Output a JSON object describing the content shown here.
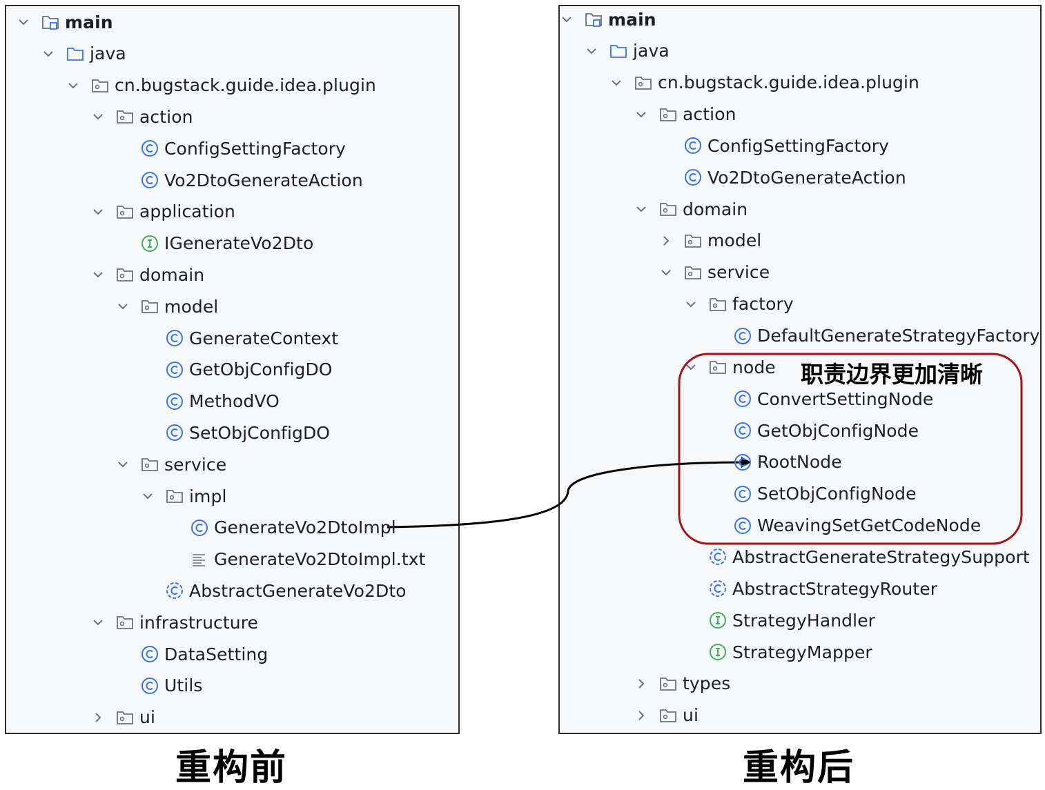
{
  "left_panel": {
    "caption": "重构前",
    "rows": [
      {
        "label": "main",
        "level": 0,
        "icon": "module",
        "expanded": true,
        "bold": true
      },
      {
        "label": "java",
        "level": 1,
        "icon": "source-folder",
        "expanded": true
      },
      {
        "label": "cn.bugstack.guide.idea.plugin",
        "level": 2,
        "icon": "package",
        "expanded": true
      },
      {
        "label": "action",
        "level": 3,
        "icon": "package",
        "expanded": true
      },
      {
        "label": "ConfigSettingFactory",
        "level": 4,
        "icon": "class"
      },
      {
        "label": "Vo2DtoGenerateAction",
        "level": 4,
        "icon": "class"
      },
      {
        "label": "application",
        "level": 3,
        "icon": "package",
        "expanded": true
      },
      {
        "label": "IGenerateVo2Dto",
        "level": 4,
        "icon": "interface"
      },
      {
        "label": "domain",
        "level": 3,
        "icon": "package",
        "expanded": true
      },
      {
        "label": "model",
        "level": 4,
        "icon": "package",
        "expanded": true
      },
      {
        "label": "GenerateContext",
        "level": 5,
        "icon": "class"
      },
      {
        "label": "GetObjConfigDO",
        "level": 5,
        "icon": "class"
      },
      {
        "label": "MethodVO",
        "level": 5,
        "icon": "class"
      },
      {
        "label": "SetObjConfigDO",
        "level": 5,
        "icon": "class"
      },
      {
        "label": "service",
        "level": 4,
        "icon": "package",
        "expanded": true
      },
      {
        "label": "impl",
        "level": 5,
        "icon": "package",
        "expanded": true
      },
      {
        "label": "GenerateVo2DtoImpl",
        "level": 6,
        "icon": "class"
      },
      {
        "label": "GenerateVo2DtoImpl.txt",
        "level": 6,
        "icon": "text-file"
      },
      {
        "label": "AbstractGenerateVo2Dto",
        "level": 5,
        "icon": "abstract-class"
      },
      {
        "label": "infrastructure",
        "level": 3,
        "icon": "package",
        "expanded": true
      },
      {
        "label": "DataSetting",
        "level": 4,
        "icon": "class"
      },
      {
        "label": "Utils",
        "level": 4,
        "icon": "class"
      },
      {
        "label": "ui",
        "level": 3,
        "icon": "package",
        "expanded": false
      }
    ]
  },
  "right_panel": {
    "caption": "重构后",
    "note": "职责边界更加清晰",
    "rows": [
      {
        "label": "main",
        "level": 0,
        "icon": "module",
        "expanded": true,
        "bold": true
      },
      {
        "label": "java",
        "level": 1,
        "icon": "source-folder",
        "expanded": true
      },
      {
        "label": "cn.bugstack.guide.idea.plugin",
        "level": 2,
        "icon": "package",
        "expanded": true
      },
      {
        "label": "action",
        "level": 3,
        "icon": "package",
        "expanded": true
      },
      {
        "label": "ConfigSettingFactory",
        "level": 4,
        "icon": "class"
      },
      {
        "label": "Vo2DtoGenerateAction",
        "level": 4,
        "icon": "class"
      },
      {
        "label": "domain",
        "level": 3,
        "icon": "package",
        "expanded": true
      },
      {
        "label": "model",
        "level": 4,
        "icon": "package",
        "expanded": false
      },
      {
        "label": "service",
        "level": 4,
        "icon": "package",
        "expanded": true
      },
      {
        "label": "factory",
        "level": 5,
        "icon": "package",
        "expanded": true
      },
      {
        "label": "DefaultGenerateStrategyFactory",
        "level": 6,
        "icon": "class"
      },
      {
        "label": "node",
        "level": 5,
        "icon": "package",
        "expanded": true
      },
      {
        "label": "ConvertSettingNode",
        "level": 6,
        "icon": "class"
      },
      {
        "label": "GetObjConfigNode",
        "level": 6,
        "icon": "class"
      },
      {
        "label": "RootNode",
        "level": 6,
        "icon": "class"
      },
      {
        "label": "SetObjConfigNode",
        "level": 6,
        "icon": "class"
      },
      {
        "label": "WeavingSetGetCodeNode",
        "level": 6,
        "icon": "class"
      },
      {
        "label": "AbstractGenerateStrategySupport",
        "level": 5,
        "icon": "abstract-class"
      },
      {
        "label": "AbstractStrategyRouter",
        "level": 5,
        "icon": "abstract-class"
      },
      {
        "label": "StrategyHandler",
        "level": 5,
        "icon": "interface"
      },
      {
        "label": "StrategyMapper",
        "level": 5,
        "icon": "interface"
      },
      {
        "label": "types",
        "level": 3,
        "icon": "package",
        "expanded": false
      },
      {
        "label": "ui",
        "level": 3,
        "icon": "package",
        "expanded": false
      }
    ]
  },
  "colors": {
    "class_icon": "#3574f0",
    "interface_icon": "#3fae58",
    "highlight_box": "#a31515",
    "folder_icon": "#6c707e",
    "connector": "#000000"
  }
}
